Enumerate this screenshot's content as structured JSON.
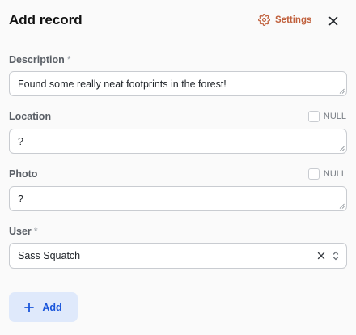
{
  "header": {
    "title": "Add record",
    "settings_label": "Settings",
    "settings_icon": "gear-icon",
    "close_icon": "close-icon"
  },
  "fields": {
    "description": {
      "label": "Description",
      "required_marker": "*",
      "value": "Found some really neat footprints in the forest!"
    },
    "location": {
      "label": "Location",
      "null_label": "NULL",
      "null_checked": false,
      "value": "?"
    },
    "photo": {
      "label": "Photo",
      "null_label": "NULL",
      "null_checked": false,
      "value": "?"
    },
    "user": {
      "label": "User",
      "required_marker": "*",
      "value": "Sass Squatch"
    }
  },
  "actions": {
    "add_label": "Add",
    "add_icon": "plus-icon"
  },
  "colors": {
    "accent": "#c0603c",
    "primary": "#1a56db",
    "primary_bg": "#dfe9fb"
  }
}
